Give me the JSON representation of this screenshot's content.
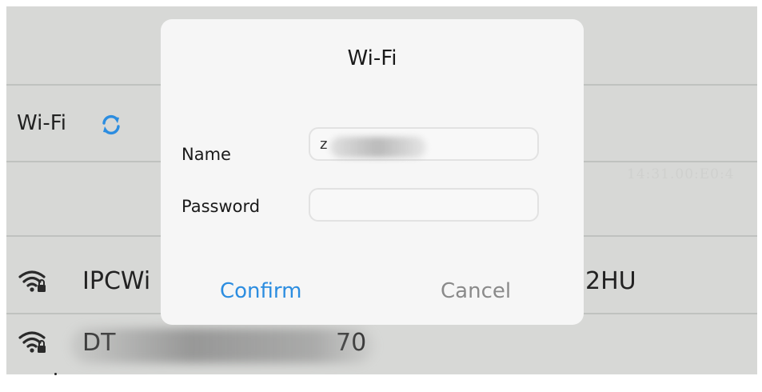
{
  "background": {
    "section_title": "Wi-Fi",
    "networks": [
      {
        "name_start": "IPCWi",
        "name_end": "2HU",
        "secured": true
      },
      {
        "name_start": "DT",
        "name_end": "70",
        "secured": true
      }
    ],
    "timestamp": "14:31.00:E0:4"
  },
  "dialog": {
    "title": "Wi-Fi",
    "name_label": "Name",
    "name_value": "z",
    "password_label": "Password",
    "password_value": "",
    "confirm_label": "Confirm",
    "cancel_label": "Cancel"
  },
  "colors": {
    "accent": "#2c8de0",
    "cancel": "#8a8a8a",
    "backdrop": "#d7d8d6",
    "dialog": "#f6f6f6"
  },
  "icons": [
    "refresh-icon",
    "wifi-lock-icon"
  ]
}
